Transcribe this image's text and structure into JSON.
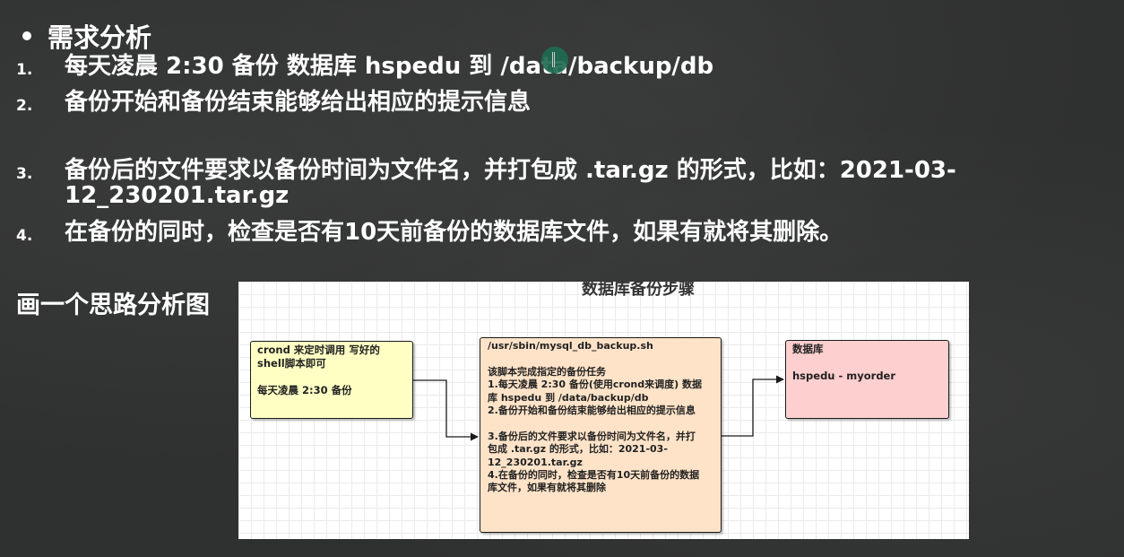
{
  "slide": {
    "title_fragment": "",
    "section_heading": "需求分析",
    "requirements": [
      {
        "num": "1.",
        "text": "每天凌晨 2:30 备份 数据库 hspedu 到 /data/backup/db"
      },
      {
        "num": "2.",
        "text": "备份开始和备份结束能够给出相应的提示信息"
      },
      {
        "num": "3.",
        "text": "备份后的文件要求以备份时间为文件名，并打包成 .tar.gz 的形式，比如：2021-03-\n12_230201.tar.gz"
      },
      {
        "num": "4.",
        "text": "在备份的同时，检查是否有10天前备份的数据库文件，如果有就将其删除。"
      }
    ],
    "draw_label": "画一个思路分析图"
  },
  "diagram": {
    "title": "数据库备份步骤",
    "boxes": {
      "trigger": "crond 来定时调用 写好的\nshell脚本即可\n\n每天凌晨 2:30 备份",
      "script": "/usr/sbin/mysql_db_backup.sh\n\n该脚本完成指定的备份任务\n1.每天凌晨 2:30 备份(使用crond来调度) 数据\n库 hspedu 到 /data/backup/db\n2.备份开始和备份结束能够给出相应的提示信息\n\n3.备份后的文件要求以备份时间为文件名，并打\n包成 .tar.gz 的形式，比如：2021-03-\n12_230201.tar.gz\n4.在备份的同时，检查是否有10天前备份的数据\n库文件，如果有就将其删除",
      "database": "数据库\n\nhspedu - myorder"
    },
    "colors": {
      "trigger_fill": "#ffffc4",
      "script_fill": "#fee3c8",
      "database_fill": "#fecfcf",
      "canvas": "#ffffff",
      "board": "#2f3030"
    }
  }
}
